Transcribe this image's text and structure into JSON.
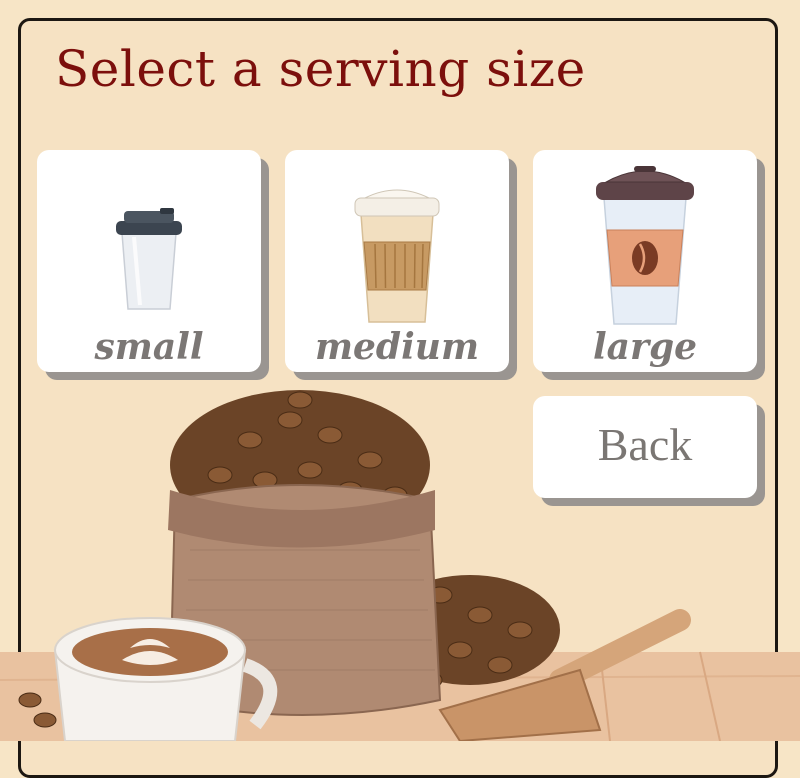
{
  "page": {
    "title": "Select a serving size"
  },
  "sizes": [
    {
      "label": "small",
      "icon": "small-cup-icon"
    },
    {
      "label": "medium",
      "icon": "medium-cup-icon"
    },
    {
      "label": "large",
      "icon": "large-cup-icon"
    }
  ],
  "back": {
    "label": "Back"
  },
  "colors": {
    "background": "#f6e2c3",
    "title": "#7c0f0c",
    "card": "#ffffff",
    "label": "#7b7775",
    "shadow": "#9a9591"
  }
}
